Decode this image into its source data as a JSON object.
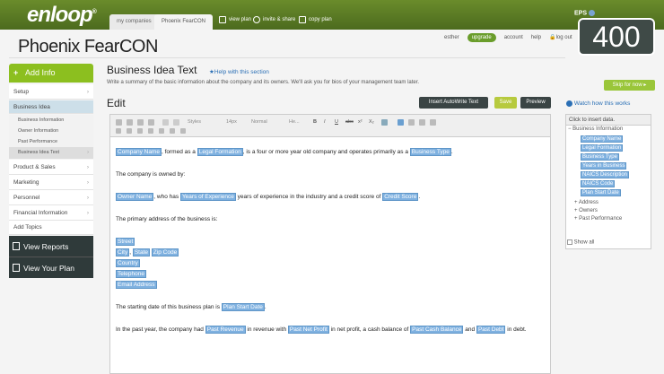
{
  "brand": {
    "logo": "enloop",
    "mark": "®"
  },
  "tabs": [
    "my companies",
    "Phoenix FearCON"
  ],
  "top_links": [
    "view plan",
    "invite & share",
    "copy plan"
  ],
  "eps": {
    "label": "EPS",
    "score": "400"
  },
  "page_title": "Phoenix FearCON",
  "user": {
    "name": "esther",
    "upgrade": "upgrade",
    "account": "account",
    "help": "help",
    "logout": "log out"
  },
  "sidebar": {
    "add_info": "Add Info",
    "setup": "Setup",
    "business_idea": "Business Idea",
    "subitems": [
      "Business Information",
      "Owner Information",
      "Past Performance",
      "Business Idea Text"
    ],
    "items": [
      "Product & Sales",
      "Marketing",
      "Personnel",
      "Financial Information",
      "Add Topics"
    ],
    "view_reports": "View Reports",
    "view_plan": "View Your Plan"
  },
  "main": {
    "title": "Business Idea Text",
    "help": "Help with this section",
    "description": "Write a summary of the basic information about the company and its owners. We'll ask you for bios of your management team later.",
    "edit": "Edit",
    "insert_autowrite": "Insert AutoWrite Text",
    "save": "Save",
    "preview": "Preview"
  },
  "toolbar": {
    "styles": "Styles",
    "size": "14px",
    "format": "Normal",
    "font": "He..."
  },
  "content": {
    "l1a": "Company Name",
    "l1b": ", formed as a ",
    "l1c": "Legal Formation",
    ", is a four or more year old company and operates primarily as a ": "",
    "l1d": ", is a four or more year old company and operates primarily as a ",
    "l1e": "Business Type",
    "l1f": ".",
    "l2": "The company is owned by:",
    "l3a": "Owner Name",
    "l3b": ", who has ",
    "l3c": "Years of Experience",
    "l3d": " years of experience in the industry and a credit score of ",
    "l3e": "Credit Score",
    "l3f": ".",
    "l4": "The primary address of the business is:",
    "street": "Street",
    "city": "City",
    "comma": ",",
    "state": "State",
    "zip": "Zip Code",
    "country": "Country",
    "telephone": "Telephone",
    "email": "Email Address",
    "l5a": "The starting date of this business plan is ",
    "l5b": "Plan Start Date",
    "l5c": ".",
    "l6a": "In the past year, the company had ",
    "l6b": "Past Revenue",
    "l6c": " in revenue with ",
    "l6d": "Past Net Profit",
    "l6e": " in net profit, a cash balance of ",
    "l6f": "Past Cash Balance",
    "l6g": " and ",
    "l6h": "Past Debt",
    "l6i": " in debt."
  },
  "right": {
    "skip": "Skip for now",
    "watch": "Watch how this works",
    "insert_header": "Click to insert data.",
    "tree_root": "Business Information",
    "fields": [
      "Company Name",
      "Legal Formation",
      "Business Type",
      "Years in Business",
      "NAICS Description",
      "NAICS Code",
      "Plan Start Date"
    ],
    "others": [
      "Address",
      "Owners",
      "Past Performance"
    ],
    "show_all": "Show all"
  }
}
